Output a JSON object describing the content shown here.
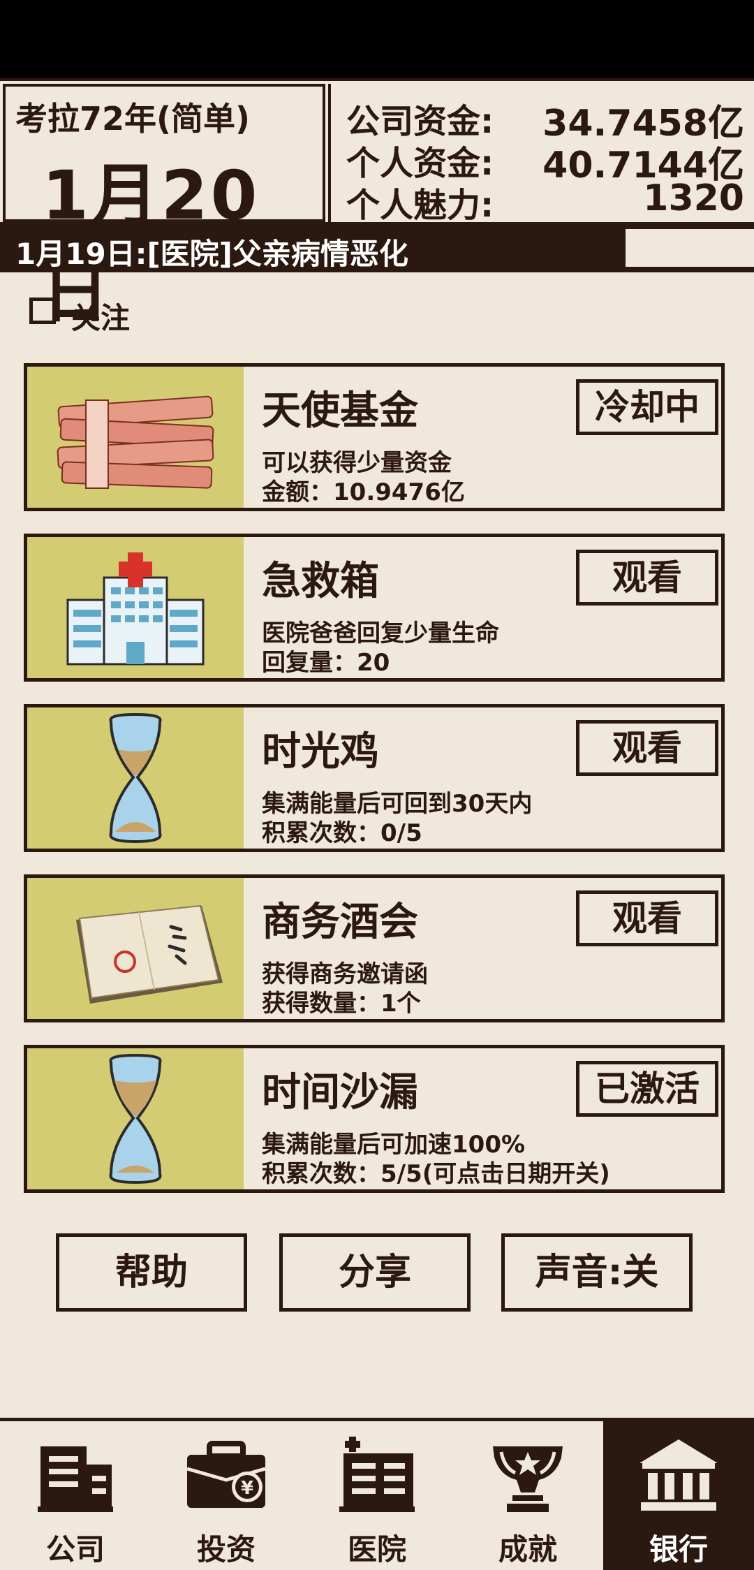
{
  "header": {
    "era": "考拉72年(简单)",
    "date": "1月20日",
    "funds": [
      {
        "label": "公司资金:",
        "value": "34.7458亿"
      },
      {
        "label": "个人资金:",
        "value": "40.7144亿"
      },
      {
        "label": "个人魅力:",
        "value": "1320"
      }
    ]
  },
  "news": "1月19日:[医院]父亲病情恶化",
  "follow_label": "关注",
  "cards": [
    {
      "title": "天使基金",
      "desc": "可以获得少量资金",
      "detail": "金额：10.9476亿",
      "button": "冷却中",
      "icon": "money-stack-icon"
    },
    {
      "title": "急救箱",
      "desc": "医院爸爸回复少量生命",
      "detail": "回复量：20",
      "button": "观看",
      "icon": "hospital-icon"
    },
    {
      "title": "时光鸡",
      "desc": "集满能量后可回到30天内",
      "detail": "积累次数：0/5",
      "button": "观看",
      "icon": "hourglass-icon"
    },
    {
      "title": "商务酒会",
      "desc": "获得商务邀请函",
      "detail": "获得数量：1个",
      "button": "观看",
      "icon": "invitation-icon"
    },
    {
      "title": "时间沙漏",
      "desc": "集满能量后可加速100%",
      "detail": "积累次数：5/5(可点击日期开关)",
      "button": "已激活",
      "icon": "hourglass-icon"
    }
  ],
  "actions": [
    "帮助",
    "分享",
    "声音:关"
  ],
  "tabs": [
    {
      "label": "公司",
      "icon": "building-icon"
    },
    {
      "label": "投资",
      "icon": "briefcase-icon"
    },
    {
      "label": "医院",
      "icon": "hospital-icon"
    },
    {
      "label": "成就",
      "icon": "trophy-icon"
    },
    {
      "label": "银行",
      "icon": "bank-icon",
      "active": true
    }
  ],
  "colors": {
    "background": "#efe8db",
    "dark": "#2b1810",
    "thumb": "#d4cc72",
    "accent_red": "#d9322b"
  }
}
